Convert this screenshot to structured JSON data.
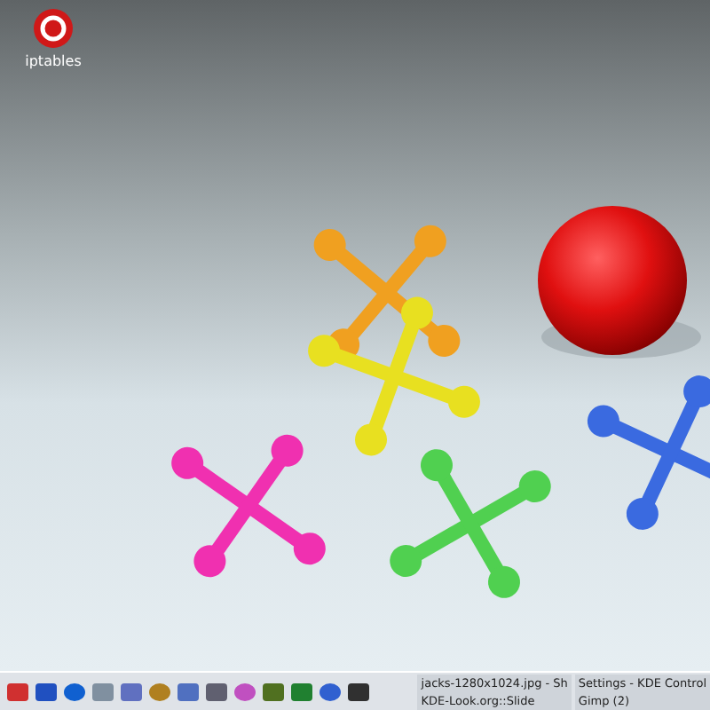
{
  "desktop": {
    "icons": [
      {
        "label": "iptables"
      }
    ]
  },
  "taskbar": {
    "tasks": [
      {
        "label": "jacks-1280x1024.jpg - Sh"
      },
      {
        "label": "Settings - KDE Control"
      },
      {
        "label": "KDE-Look.org::Slide"
      },
      {
        "label": "Gimp (2)"
      }
    ]
  }
}
